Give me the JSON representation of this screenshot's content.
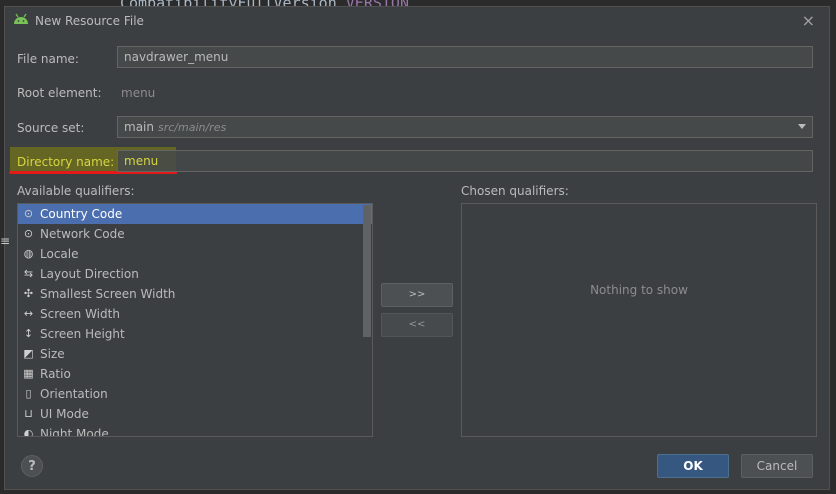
{
  "window": {
    "title": "New Resource File",
    "close_label": "×"
  },
  "form": {
    "file_name_label": "File name:",
    "file_name_value": "navdrawer_menu",
    "root_element_label": "Root element:",
    "root_element_value": "menu",
    "source_set_label": "Source set:",
    "source_set_value": "main",
    "source_set_hint": "src/main/res",
    "directory_label": "Directory name:",
    "directory_value": "menu"
  },
  "available": {
    "label": "Available qualifiers:",
    "items": [
      {
        "label": "Country Code",
        "icon": "country-code-icon",
        "glyph": "⊙",
        "selected": true
      },
      {
        "label": "Network Code",
        "icon": "network-code-icon",
        "glyph": "⊙",
        "selected": false
      },
      {
        "label": "Locale",
        "icon": "globe-icon",
        "glyph": "◍",
        "selected": false
      },
      {
        "label": "Layout Direction",
        "icon": "layout-direction-icon",
        "glyph": "⇆",
        "selected": false
      },
      {
        "label": "Smallest Screen Width",
        "icon": "smallest-width-icon",
        "glyph": "✣",
        "selected": false
      },
      {
        "label": "Screen Width",
        "icon": "screen-width-icon",
        "glyph": "↔",
        "selected": false
      },
      {
        "label": "Screen Height",
        "icon": "screen-height-icon",
        "glyph": "↕",
        "selected": false
      },
      {
        "label": "Size",
        "icon": "size-icon",
        "glyph": "◩",
        "selected": false
      },
      {
        "label": "Ratio",
        "icon": "ratio-icon",
        "glyph": "▦",
        "selected": false
      },
      {
        "label": "Orientation",
        "icon": "orientation-icon",
        "glyph": "▯",
        "selected": false
      },
      {
        "label": "UI Mode",
        "icon": "ui-mode-icon",
        "glyph": "⊔",
        "selected": false
      },
      {
        "label": "Night Mode",
        "icon": "night-mode-icon",
        "glyph": "◐",
        "selected": false
      }
    ]
  },
  "chosen": {
    "label": "Chosen qualifiers:",
    "empty_text": "Nothing to show"
  },
  "buttons": {
    "add": ">>",
    "remove": "<<",
    "ok": "OK",
    "cancel": "Cancel",
    "help": "?"
  },
  "background": {
    "code_fragment": "CompatibilityFullVersion",
    "keyword": "VERSION"
  },
  "colors": {
    "highlight": "#969600",
    "underline": "#e31a1a",
    "selection": "#4b6eaf"
  }
}
